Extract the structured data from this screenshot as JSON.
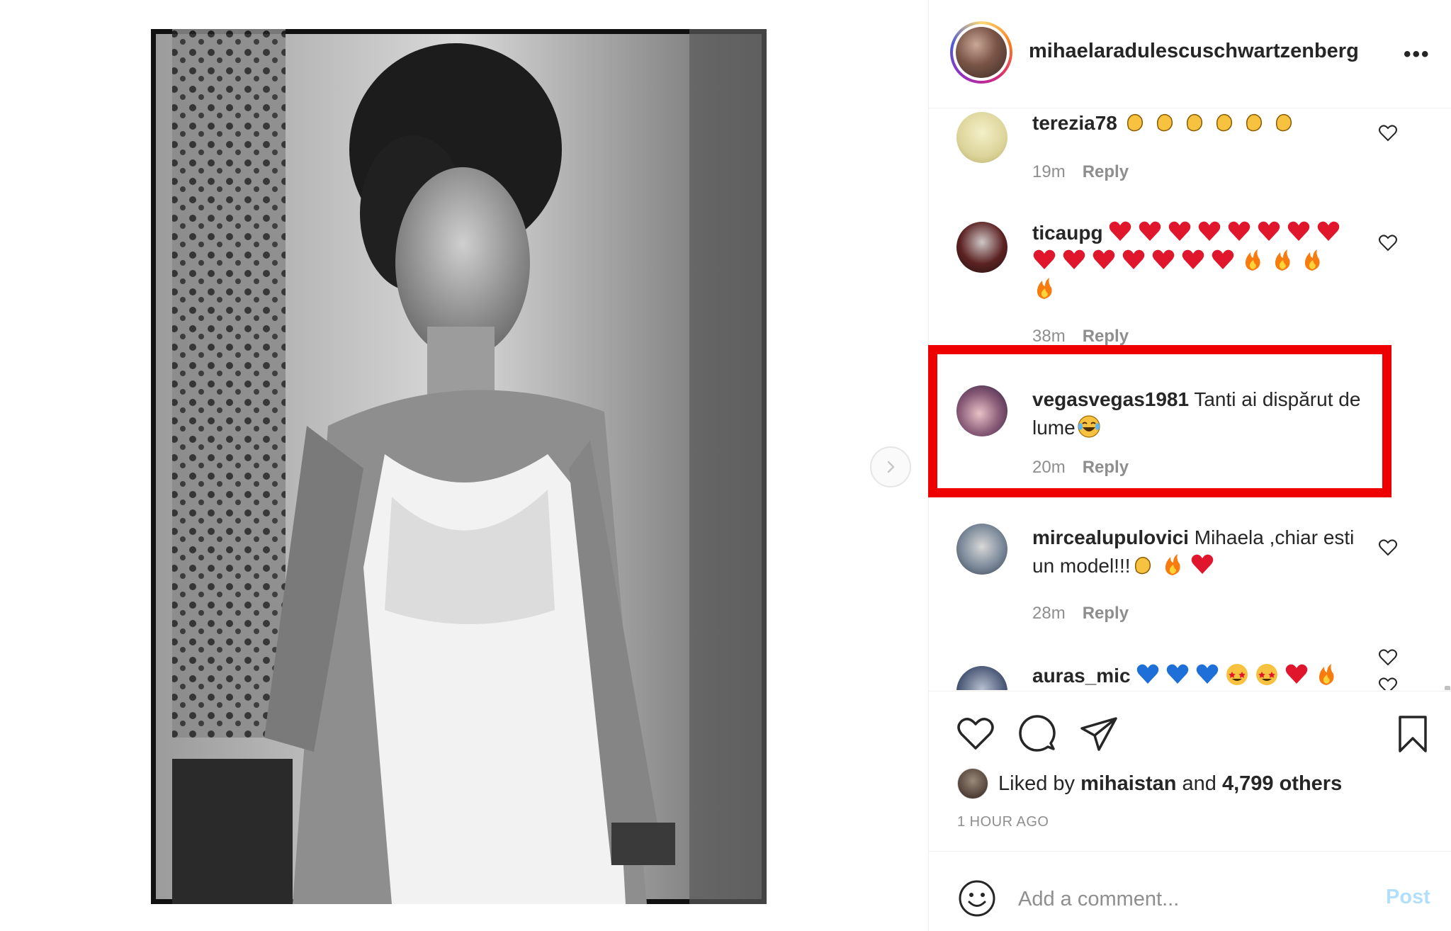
{
  "header": {
    "username": "mihaelaradulescuschwartzenberg",
    "more_label": "•••"
  },
  "comments": [
    {
      "username": "terezia78",
      "text": "",
      "emojis": [
        "clap",
        "clap",
        "clap",
        "clap",
        "clap",
        "clap"
      ],
      "time": "19m",
      "reply": "Reply"
    },
    {
      "username": "ticaupg",
      "text": "",
      "emojis": [
        "heart",
        "heart",
        "heart",
        "heart",
        "heart",
        "heart",
        "heart",
        "heart",
        "heart",
        "heart",
        "heart",
        "heart",
        "heart",
        "heart",
        "heart",
        "fire",
        "fire",
        "fire",
        "fire"
      ],
      "time": "38m",
      "reply": "Reply"
    },
    {
      "username": "vegasvegas1981",
      "text": "Tanti ai dispărut de lume",
      "emojis": [
        "laugh"
      ],
      "time": "20m",
      "reply": "Reply"
    },
    {
      "username": "mircealupulovici",
      "text": "Mihaela ,chiar esti un model!!!",
      "emojis": [
        "clap",
        "fire",
        "heart"
      ],
      "time": "28m",
      "reply": "Reply"
    },
    {
      "username": "auras_mic",
      "text": "",
      "emojis": [
        "blue-heart",
        "blue-heart",
        "blue-heart",
        "star-eyes",
        "star-eyes",
        "heart",
        "fire"
      ],
      "time": "",
      "reply": ""
    }
  ],
  "likes": {
    "prefix": "Liked by",
    "user": "mihaistan",
    "joiner": "and",
    "others": "4,799 others"
  },
  "timestamp": "1 HOUR AGO",
  "add_comment": {
    "placeholder": "Add a comment...",
    "post_label": "Post"
  },
  "colors": {
    "highlight": "#ee0000",
    "post_disabled": "#b2dffc",
    "meta": "#8e8e8e",
    "text": "#262626"
  },
  "icons": {
    "clap": "clapping-hands-emoji",
    "heart": "red-heart-emoji",
    "fire": "fire-emoji",
    "laugh": "tears-of-joy-emoji",
    "blue-heart": "blue-heart-emoji",
    "star-eyes": "star-struck-emoji"
  }
}
